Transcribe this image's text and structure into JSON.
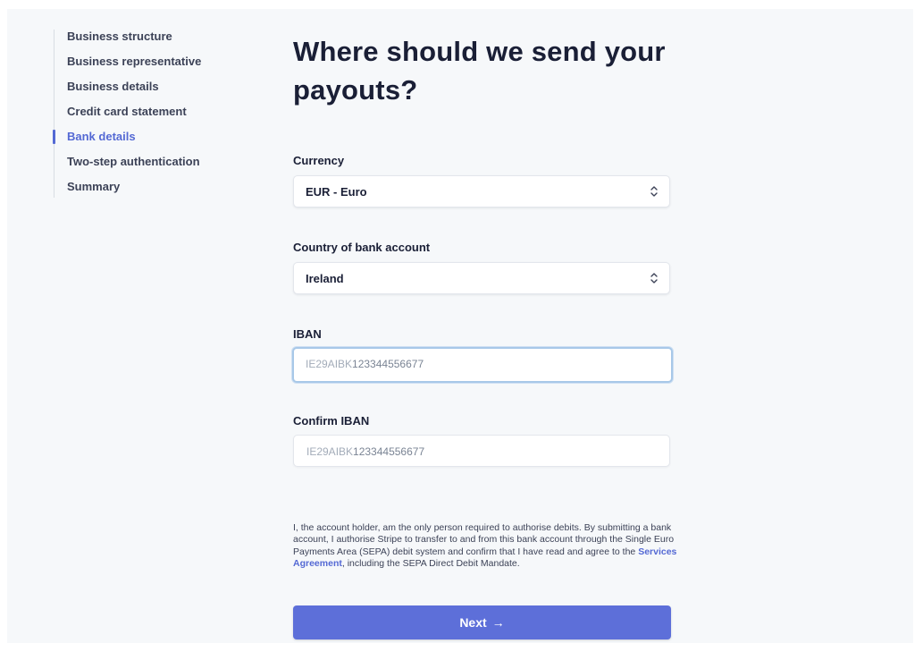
{
  "sidebar": {
    "steps": [
      {
        "label": "Business structure",
        "active": false
      },
      {
        "label": "Business representative",
        "active": false
      },
      {
        "label": "Business details",
        "active": false
      },
      {
        "label": "Credit card statement",
        "active": false
      },
      {
        "label": "Bank details",
        "active": true
      },
      {
        "label": "Two-step authentication",
        "active": false
      },
      {
        "label": "Summary",
        "active": false
      }
    ]
  },
  "main": {
    "title": "Where should we send your payouts?",
    "currency": {
      "label": "Currency",
      "value": "EUR - Euro"
    },
    "country": {
      "label": "Country of bank account",
      "value": "Ireland"
    },
    "iban": {
      "label": "IBAN",
      "value_prefix": "IE29AIBK",
      "value_rest": "123344556677"
    },
    "confirm_iban": {
      "label": "Confirm IBAN",
      "value_prefix": "IE29AIBK",
      "value_rest": "123344556677"
    },
    "legal": {
      "text_before": "I, the account holder, am the only person required to authorise debits. By submitting a bank account, I authorise Stripe to transfer to and from this bank account through the Single Euro Payments Area (SEPA) debit system and confirm that I have read and agree to the ",
      "link": "Services Agreement",
      "text_after": ", including the SEPA Direct Debit Mandate."
    },
    "next_button": {
      "label": "Next",
      "arrow": "→"
    }
  },
  "colors": {
    "accent": "#5469d4",
    "button": "#5d6fd9",
    "background": "#f6f8fa"
  },
  "icons": {
    "select_chevron": "chevron-up-down-icon",
    "next_arrow": "arrow-right-icon"
  }
}
